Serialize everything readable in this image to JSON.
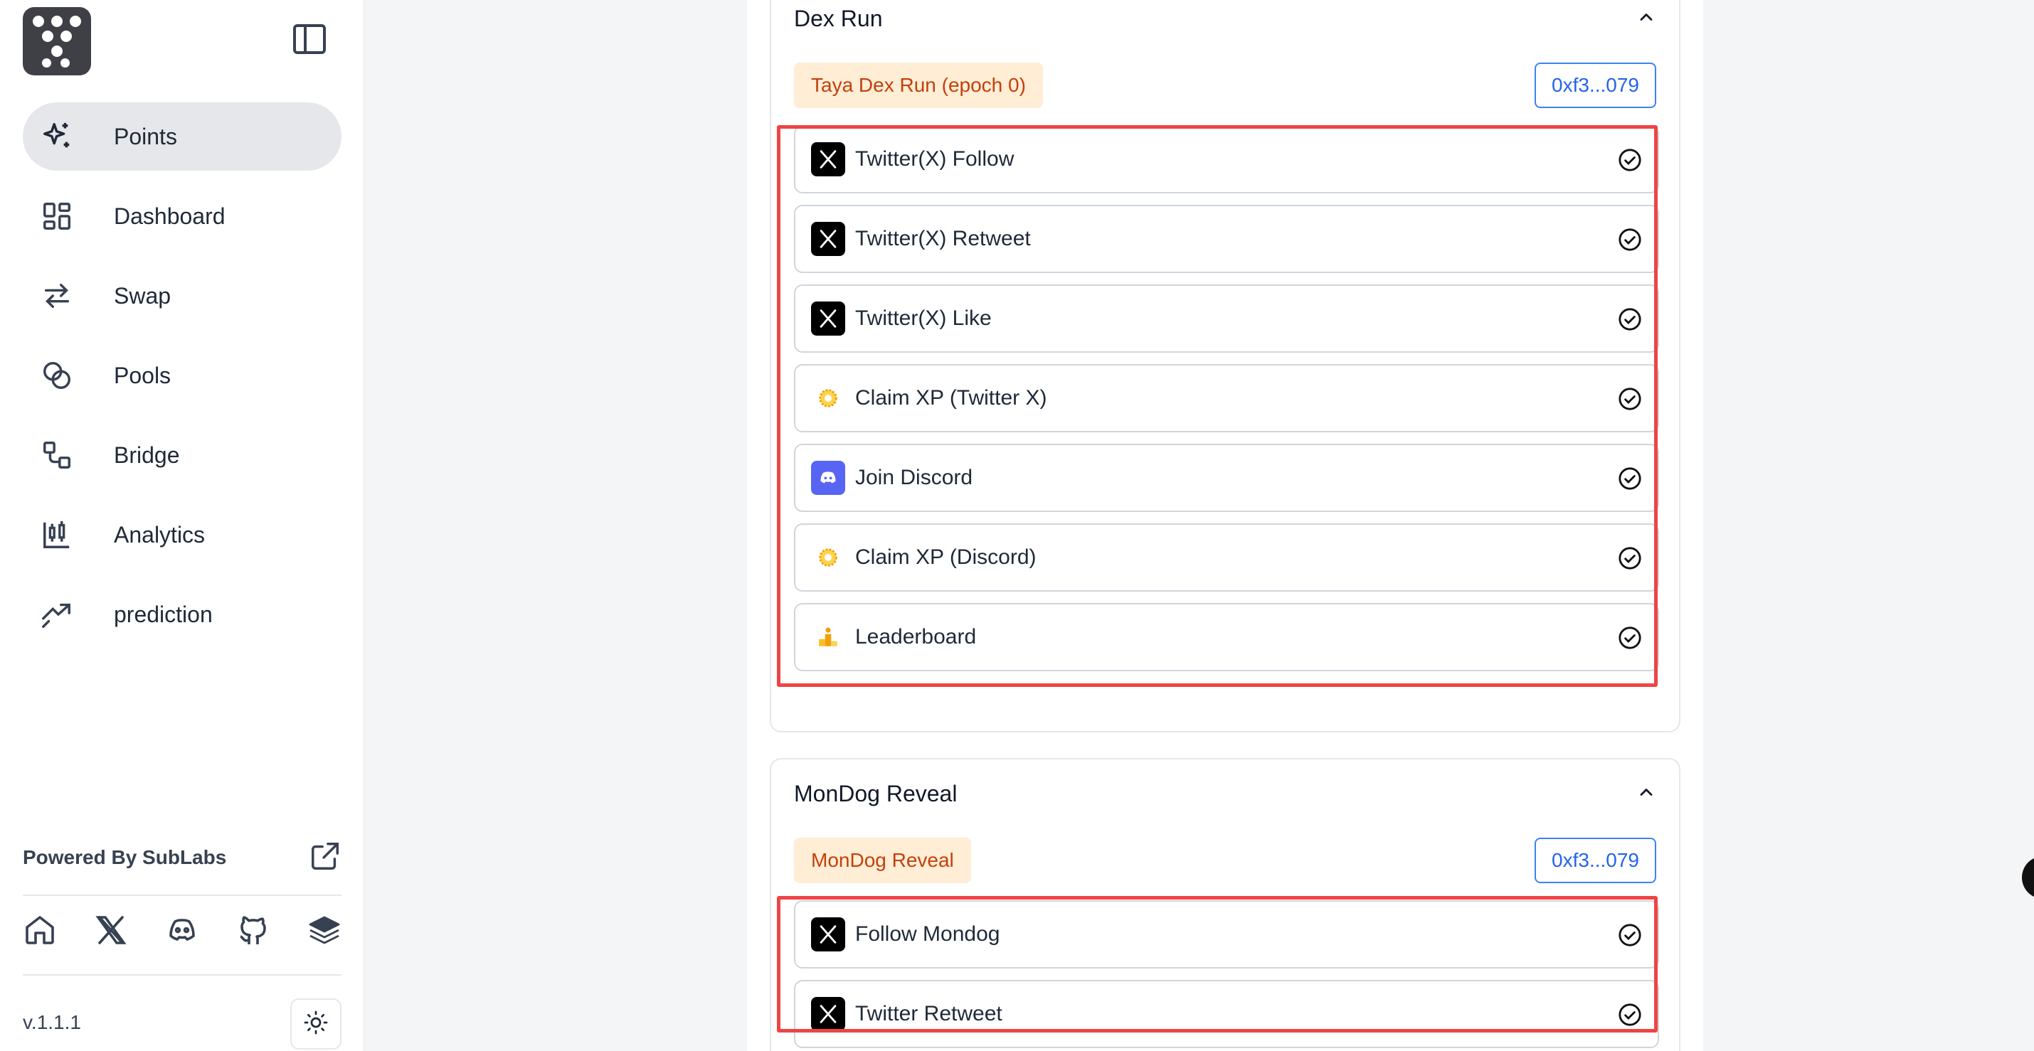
{
  "sidebar": {
    "nav": [
      {
        "label": "Points",
        "icon": "sparkles-icon",
        "active": true
      },
      {
        "label": "Dashboard",
        "icon": "dashboard-icon"
      },
      {
        "label": "Swap",
        "icon": "swap-arrows-icon"
      },
      {
        "label": "Pools",
        "icon": "pools-circles-icon"
      },
      {
        "label": "Bridge",
        "icon": "bridge-icon"
      },
      {
        "label": "Analytics",
        "icon": "candlestick-icon"
      },
      {
        "label": "prediction",
        "icon": "trending-up-icon"
      }
    ],
    "powered_by": "Powered By SubLabs",
    "social": [
      "home-icon",
      "x-icon",
      "discord-icon",
      "github-icon",
      "layers-icon"
    ],
    "version": "v.1.1.1"
  },
  "cards": [
    {
      "title": "Dex Run",
      "tag": "Taya Dex Run (epoch 0)",
      "address": "0xf3...079",
      "tasks": [
        {
          "label": "Twitter(X) Follow",
          "icon": "x-icon"
        },
        {
          "label": "Twitter(X) Retweet",
          "icon": "x-icon"
        },
        {
          "label": "Twitter(X) Like",
          "icon": "x-icon"
        },
        {
          "label": "Claim XP (Twitter X)",
          "icon": "xp-coin-icon"
        },
        {
          "label": "Join Discord",
          "icon": "discord-icon"
        },
        {
          "label": "Claim XP (Discord)",
          "icon": "xp-coin-icon"
        },
        {
          "label": "Leaderboard",
          "icon": "podium-icon"
        }
      ]
    },
    {
      "title": "MonDog Reveal",
      "tag": "MonDog Reveal",
      "address": "0xf3...079",
      "tasks": [
        {
          "label": "Follow Mondog",
          "icon": "x-icon"
        },
        {
          "label": "Twitter Retweet",
          "icon": "x-icon"
        }
      ]
    }
  ]
}
